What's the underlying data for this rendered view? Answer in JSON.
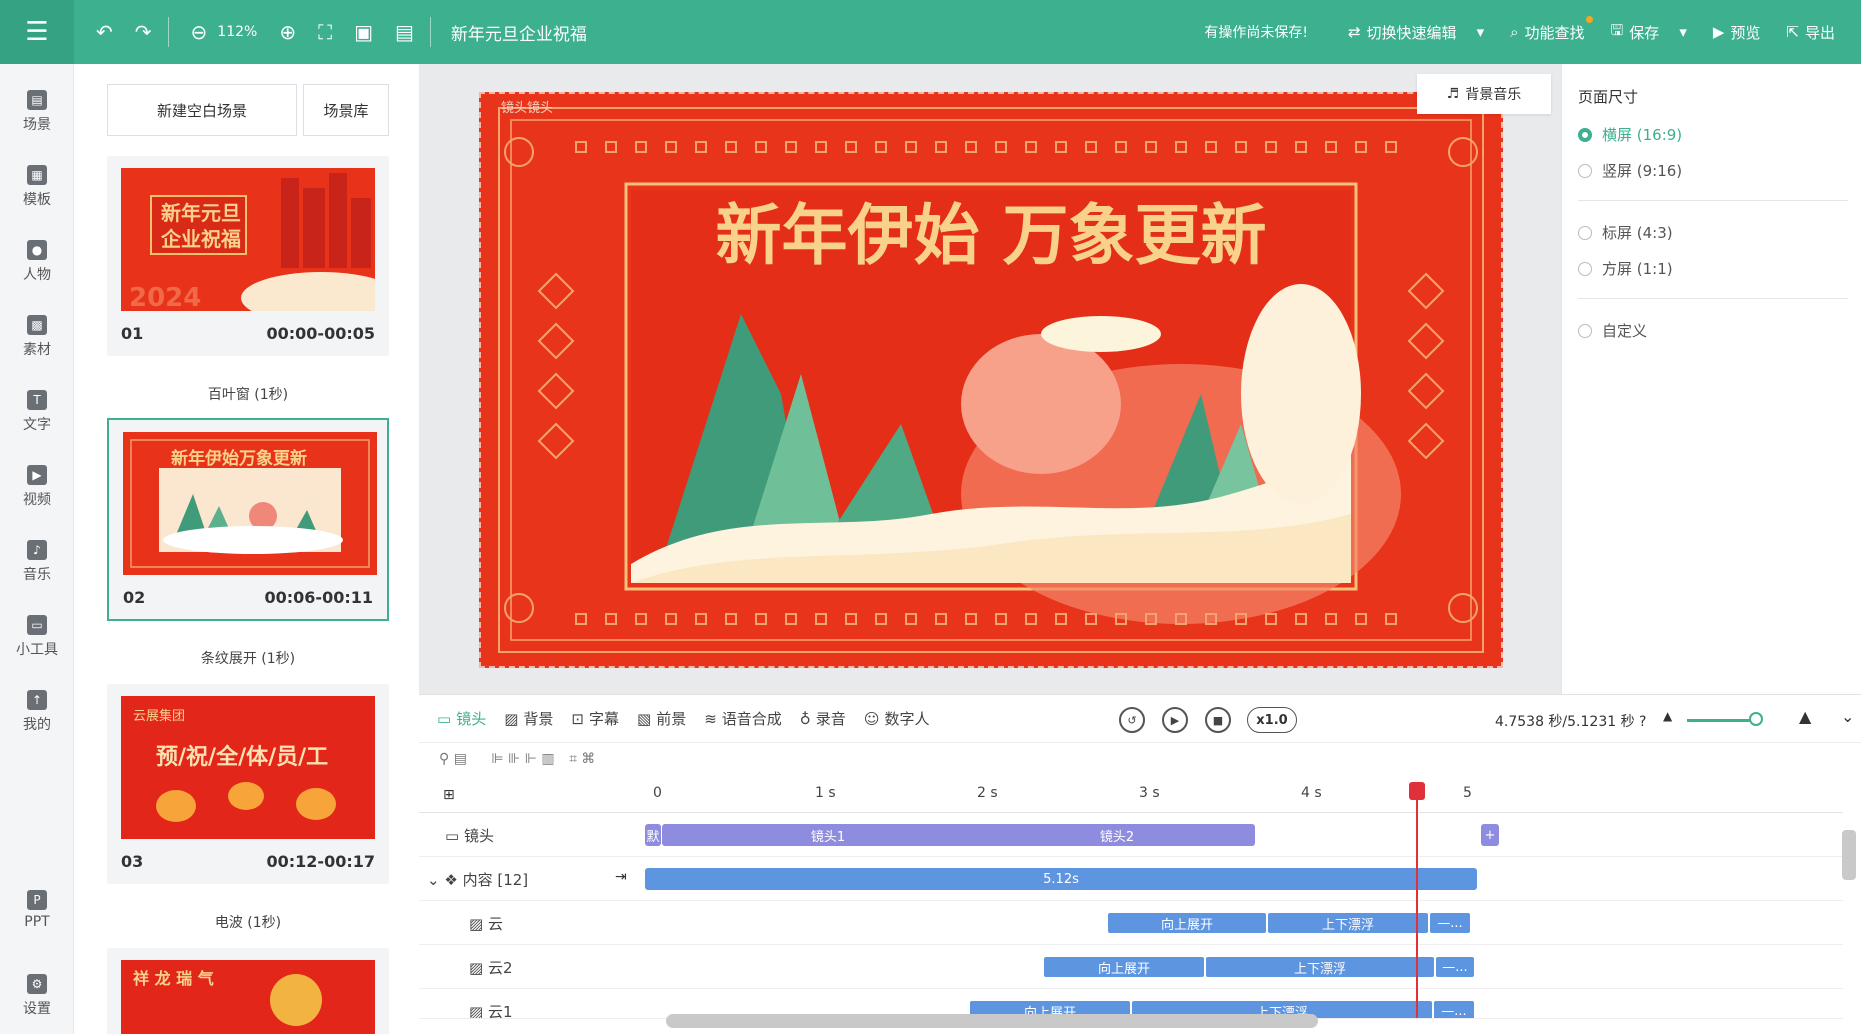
{
  "topbar": {
    "zoom": "112%",
    "doc_title": "新年元旦企业祝福",
    "unsaved": "有操作尚未保存!",
    "switch_edit": "切换快速编辑",
    "feature_search": "功能查找",
    "save": "保存",
    "preview": "预览",
    "export": "导出"
  },
  "sidebar": {
    "items": [
      {
        "label": "场景",
        "icon": "scene-icon"
      },
      {
        "label": "模板",
        "icon": "template-icon"
      },
      {
        "label": "人物",
        "icon": "person-icon"
      },
      {
        "label": "素材",
        "icon": "asset-icon"
      },
      {
        "label": "文字",
        "icon": "text-icon"
      },
      {
        "label": "视频",
        "icon": "video-icon"
      },
      {
        "label": "音乐",
        "icon": "music-icon"
      },
      {
        "label": "小工具",
        "icon": "toolbox-icon"
      },
      {
        "label": "我的",
        "icon": "my-icon"
      },
      {
        "label": "PPT",
        "icon": "ppt-icon"
      },
      {
        "label": "设置",
        "icon": "settings-icon"
      }
    ]
  },
  "scenes": {
    "new_blank": "新建空白场景",
    "library": "场景库",
    "list": [
      {
        "num": "01",
        "time": "00:00-00:05",
        "transition": "百叶窗 (1秒)",
        "thumb_title": "新年元旦\n企业祝福"
      },
      {
        "num": "02",
        "time": "00:06-00:11",
        "transition": "条纹展开 (1秒)",
        "thumb_title": "新年伊始万象更新"
      },
      {
        "num": "03",
        "time": "00:12-00:17",
        "transition": "电波 (1秒)",
        "thumb_title": "预/祝/全/体/员/工"
      }
    ],
    "fourth_thumb_title": "祥 龙 瑞 气"
  },
  "canvas": {
    "bgm": "背景音乐",
    "lens_label": "镜头镜头",
    "headline": "新年伊始 万象更新"
  },
  "props": {
    "title": "页面尺寸",
    "options": [
      {
        "label": "横屏 (16:9)",
        "selected": true
      },
      {
        "label": "竖屏 (9:16)",
        "selected": false
      },
      {
        "label": "标屏 (4:3)",
        "selected": false
      },
      {
        "label": "方屏 (1:1)",
        "selected": false
      },
      {
        "label": "自定义",
        "selected": false
      }
    ]
  },
  "timeline": {
    "tabs": [
      "镜头",
      "背景",
      "字幕",
      "前景",
      "语音合成",
      "录音",
      "数字人"
    ],
    "speed": "x1.0",
    "timecode": "4.7538 秒/5.1231 秒",
    "ruler": [
      "0",
      "1 s",
      "2 s",
      "3 s",
      "4 s",
      "5"
    ],
    "rows": {
      "lens": "镜头",
      "content": "内容 [12]",
      "cloud": "云",
      "cloud2": "云2",
      "cloud1": "云1"
    },
    "clips": {
      "lens_default": "默",
      "lens1": "镜头1",
      "lens2": "镜头2",
      "content": "5.12s",
      "rise": "向上展开",
      "float": "上下漂浮",
      "more": "—..."
    }
  }
}
